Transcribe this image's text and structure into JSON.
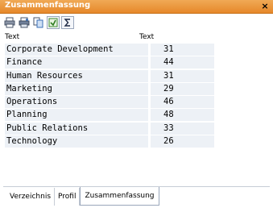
{
  "window": {
    "title": "Zusammenfassung",
    "close_symbol": "×"
  },
  "toolbar": {
    "buttons": [
      {
        "icon": "print-icon"
      },
      {
        "icon": "print-preview-icon"
      },
      {
        "icon": "copy-icon"
      },
      {
        "icon": "export-icon"
      },
      {
        "icon": "sum-icon"
      }
    ]
  },
  "table": {
    "headers": [
      "Text",
      "Text"
    ],
    "rows": [
      {
        "text": "Corporate Development",
        "value": "31"
      },
      {
        "text": "Finance",
        "value": "44"
      },
      {
        "text": "Human Resources",
        "value": "31"
      },
      {
        "text": "Marketing",
        "value": "29"
      },
      {
        "text": "Operations",
        "value": "46"
      },
      {
        "text": "Planning",
        "value": "48"
      },
      {
        "text": "Public Relations",
        "value": "33"
      },
      {
        "text": "Technology",
        "value": "26"
      }
    ]
  },
  "tabs": {
    "items": [
      "Verzeichnis",
      "Profil",
      "Zusammenfassung"
    ],
    "active": "Zusammenfassung"
  },
  "colors": {
    "titlebar": "#e6882a",
    "row_background": "#edf1f6"
  }
}
